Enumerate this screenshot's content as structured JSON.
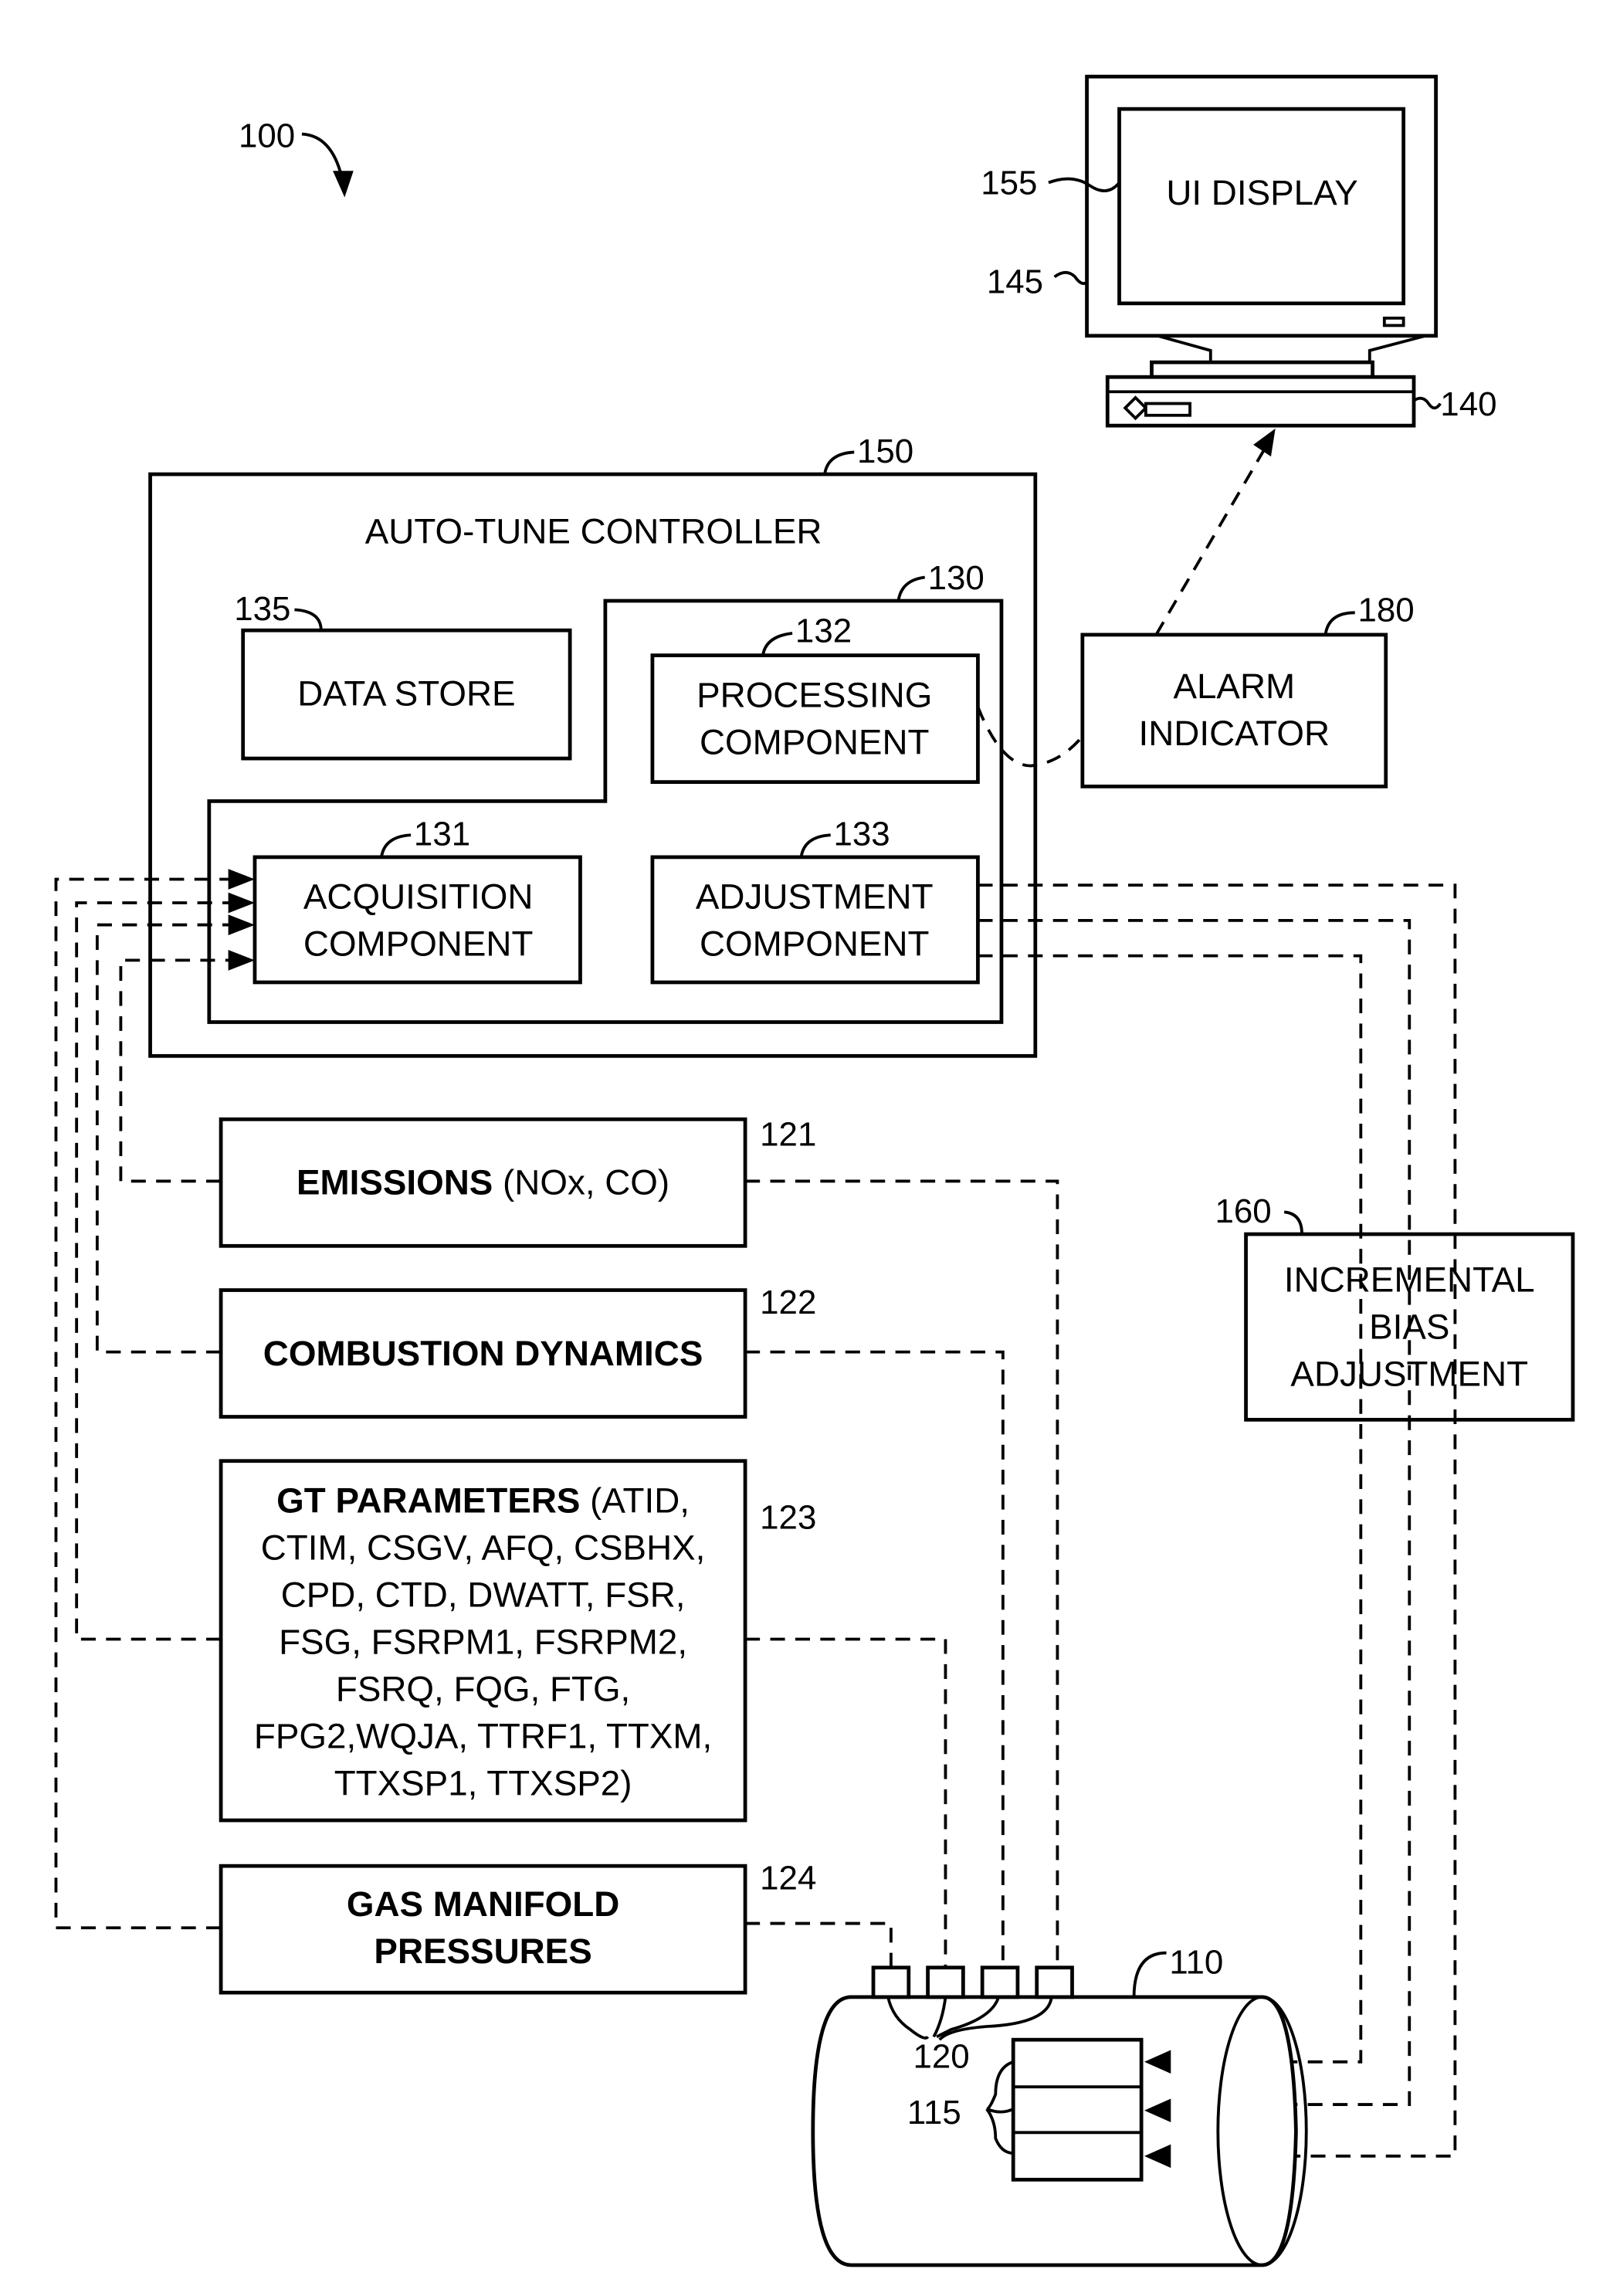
{
  "figure": {
    "ref": "100",
    "controller": {
      "ref": "150",
      "title": "AUTO-TUNE CONTROLLER"
    },
    "data_store": {
      "ref": "135",
      "label": "DATA STORE"
    },
    "component_group": {
      "ref": "130"
    },
    "processing": {
      "ref": "132",
      "line1": "PROCESSING",
      "line2": "COMPONENT"
    },
    "acquisition": {
      "ref": "131",
      "line1": "ACQUISITION",
      "line2": "COMPONENT"
    },
    "adjustment": {
      "ref": "133",
      "line1": "ADJUSTMENT",
      "line2": "COMPONENT"
    },
    "alarm": {
      "ref": "180",
      "line1": "ALARM",
      "line2": "INDICATOR"
    },
    "computer": {
      "ref": "140",
      "monitor_ref": "145",
      "display_ref": "155",
      "display_label": "UI DISPLAY"
    },
    "emissions": {
      "ref": "121",
      "bold": "EMISSIONS",
      "rest": " (NOx, CO)"
    },
    "combustion": {
      "ref": "122",
      "bold": "COMBUSTION DYNAMICS"
    },
    "gt_params": {
      "ref": "123",
      "bold": "GT PARAMETERS",
      "line1_rest": " (ATID,",
      "lines": [
        "CTIM, CSGV, AFQ, CSBHX,",
        "CPD, CTD, DWATT, FSR,",
        "FSG, FSRPM1, FSRPM2,",
        "FSRQ, FQG, FTG,",
        "FPG2,WQJA, TTRF1, TTXM,",
        "TTXSP1, TTXSP2)"
      ]
    },
    "gas_manifold": {
      "ref": "124",
      "line1": "GAS MANIFOLD",
      "line2": "PRESSURES"
    },
    "bias": {
      "ref": "160",
      "line1": "INCREMENTAL",
      "line2": "BIAS",
      "line3": "ADJUSTMENT"
    },
    "turbine": {
      "ref": "110",
      "sensors_ref": "120",
      "actuators_ref": "115"
    }
  }
}
